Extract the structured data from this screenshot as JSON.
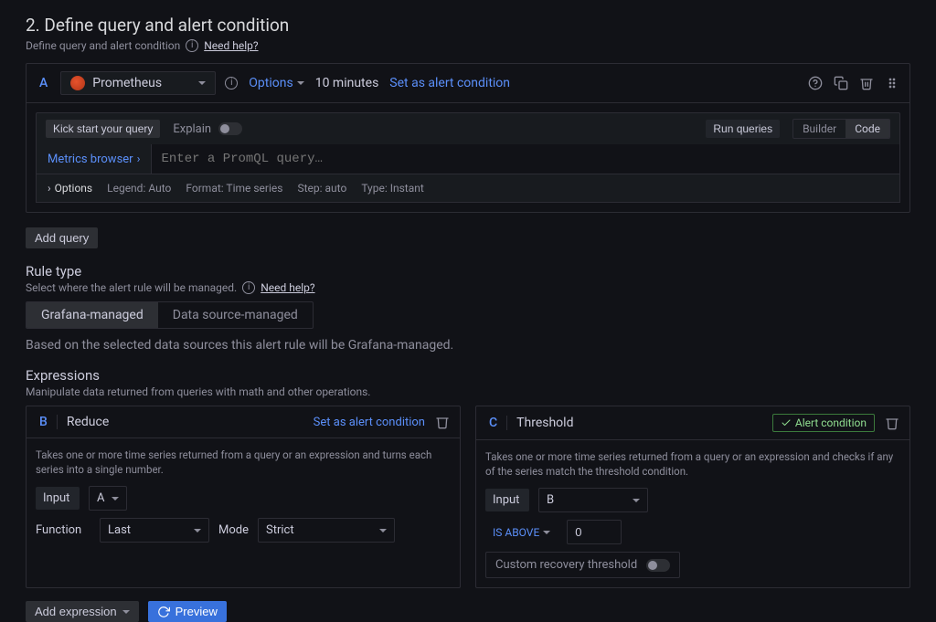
{
  "section": {
    "title": "2. Define query and alert condition",
    "subtitle": "Define query and alert condition",
    "help": "Need help?"
  },
  "query": {
    "ref": "A",
    "datasource": "Prometheus",
    "options_label": "Options",
    "interval": "10 minutes",
    "set_condition": "Set as alert condition",
    "toolbar": {
      "kickstart": "Kick start your query",
      "explain": "Explain",
      "run": "Run queries",
      "builder": "Builder",
      "code": "Code"
    },
    "metrics_browser": "Metrics browser",
    "placeholder": "Enter a PromQL query…",
    "opts": {
      "label": "Options",
      "legend": "Legend: Auto",
      "format": "Format: Time series",
      "step": "Step: auto",
      "type": "Type: Instant"
    }
  },
  "add_query": "Add query",
  "rule_type": {
    "label": "Rule type",
    "sub": "Select where the alert rule will be managed.",
    "help": "Need help?",
    "grafana": "Grafana-managed",
    "ds": "Data source-managed",
    "note": "Based on the selected data sources this alert rule will be Grafana-managed."
  },
  "expressions": {
    "label": "Expressions",
    "sub": "Manipulate data returned from queries with math and other operations."
  },
  "reduce": {
    "ref": "B",
    "title": "Reduce",
    "set_condition": "Set as alert condition",
    "desc": "Takes one or more time series returned from a query or an expression and turns each series into a single number.",
    "input_lbl": "Input",
    "input_val": "A",
    "func_lbl": "Function",
    "func_val": "Last",
    "mode_lbl": "Mode",
    "mode_val": "Strict"
  },
  "threshold": {
    "ref": "C",
    "title": "Threshold",
    "badge": "Alert condition",
    "desc": "Takes one or more time series returned from a query or an expression and checks if any of the series match the threshold condition.",
    "input_lbl": "Input",
    "input_val": "B",
    "op": "IS ABOVE",
    "val": "0",
    "recovery": "Custom recovery threshold"
  },
  "bottom": {
    "add_expr": "Add expression",
    "preview": "Preview"
  }
}
